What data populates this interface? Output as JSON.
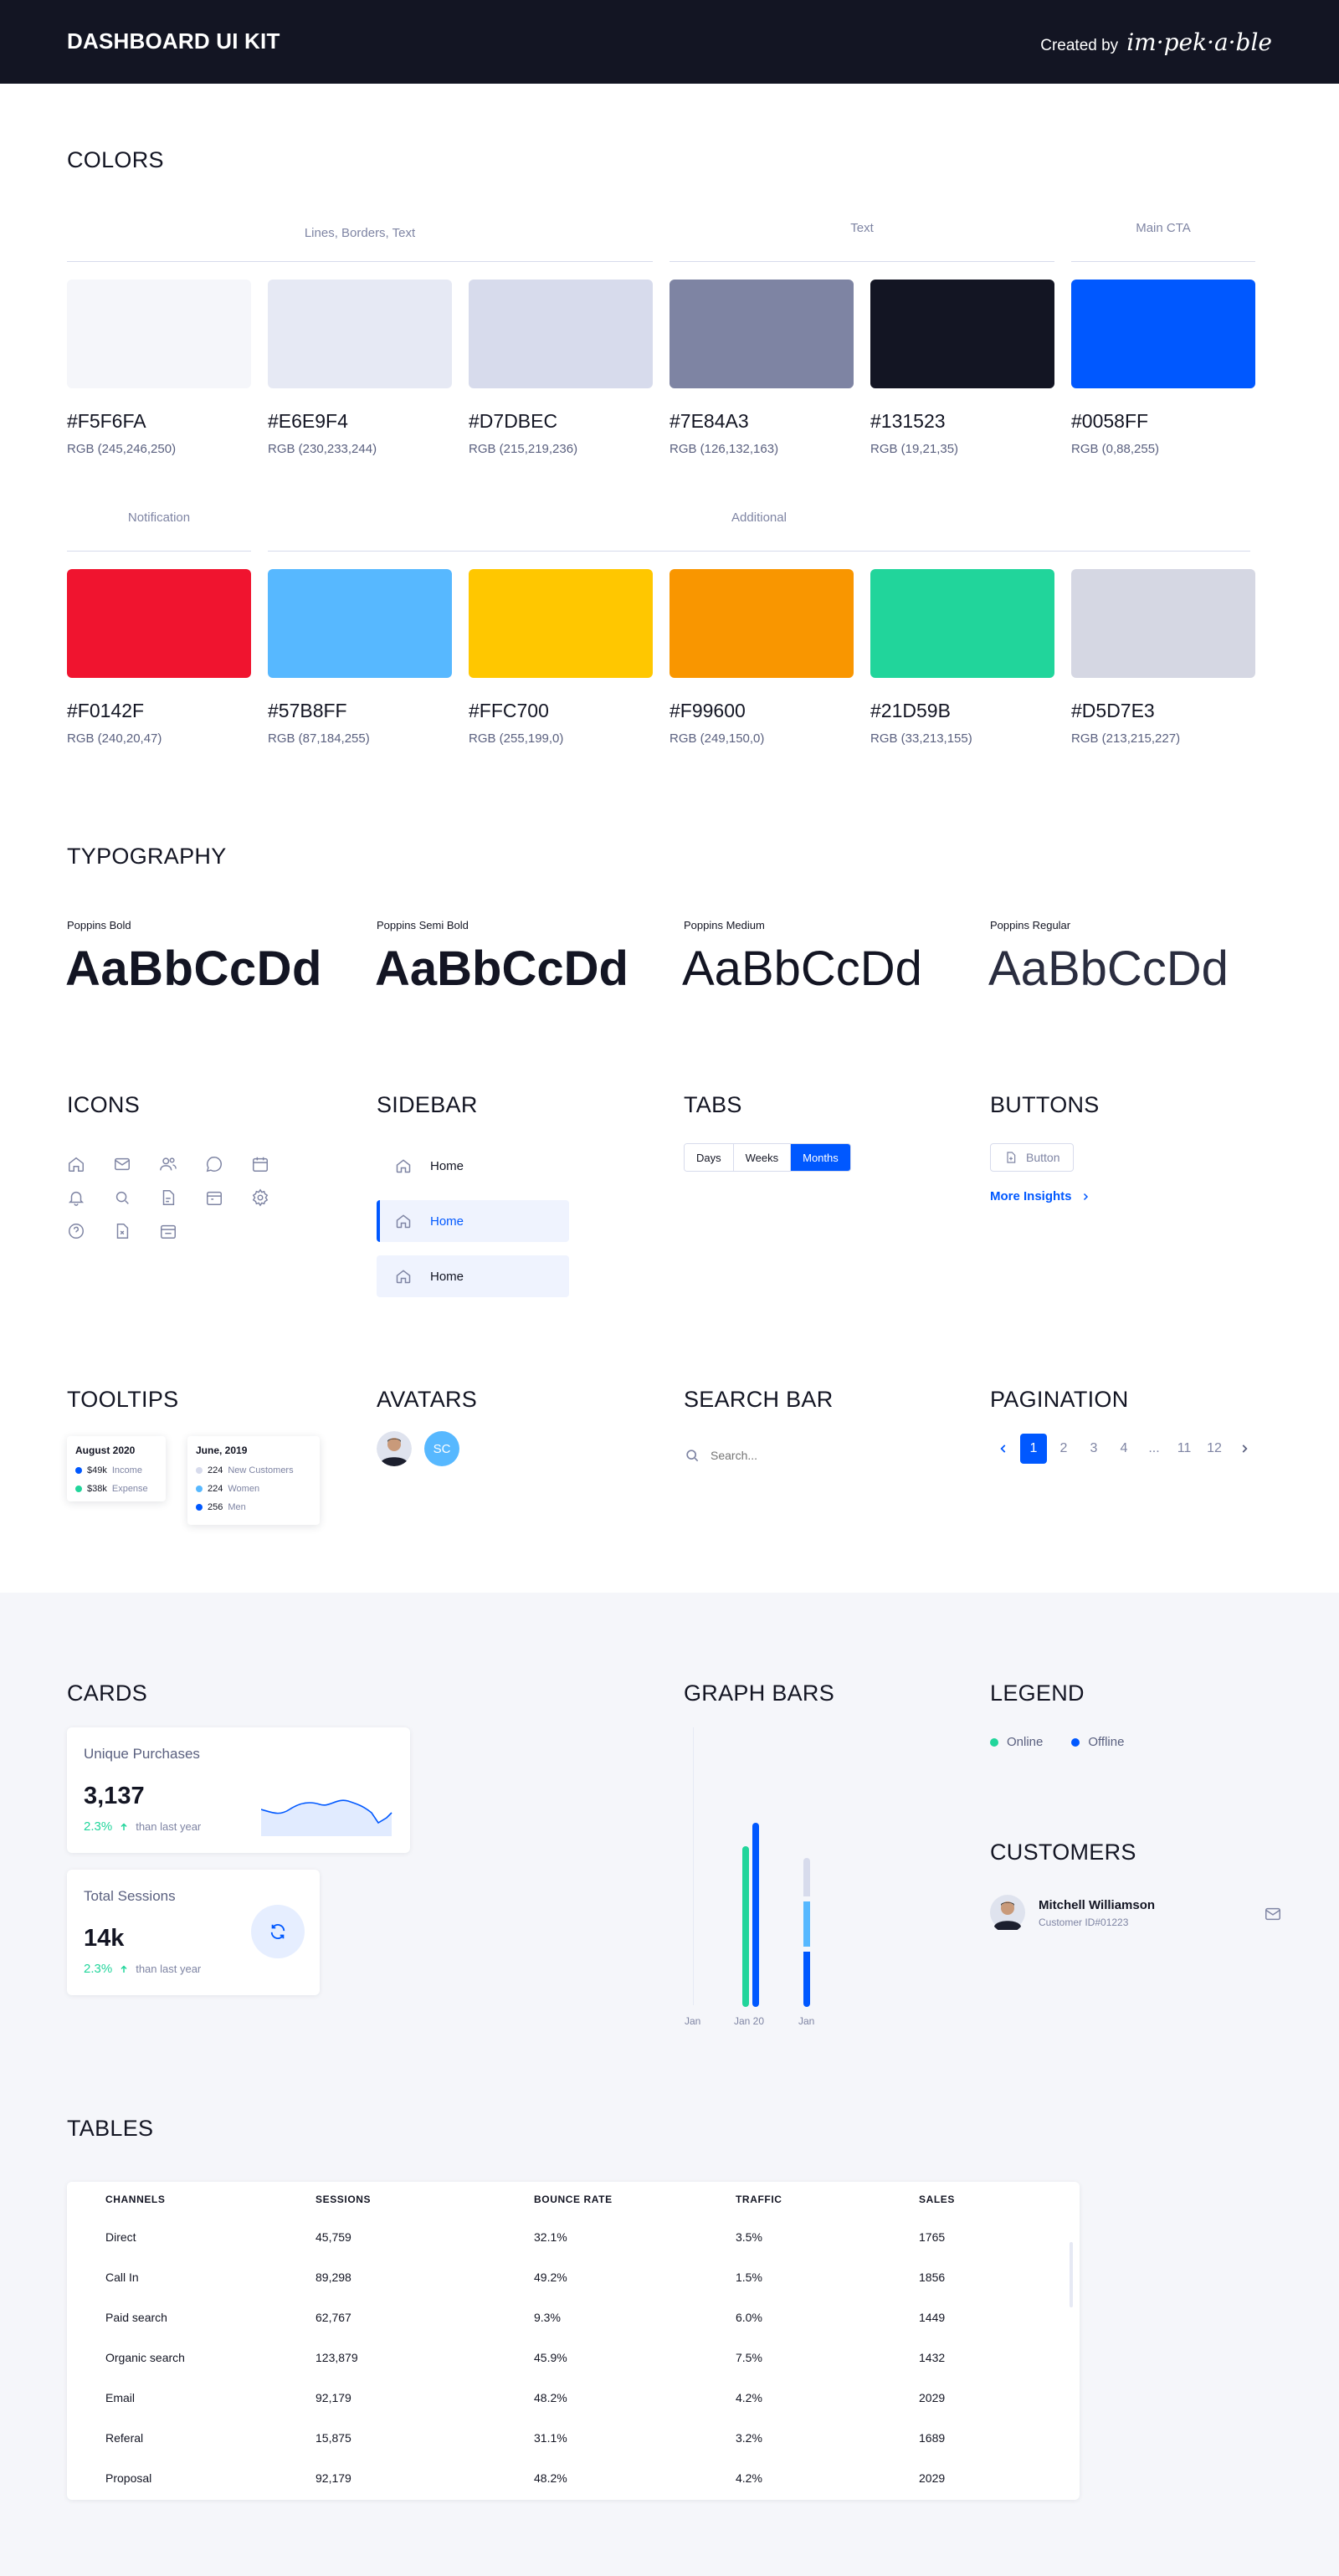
{
  "header": {
    "title": "DASHBOARD UI KIT",
    "created_by": "Created by",
    "brand": "im·pek·a·ble"
  },
  "colors": {
    "title": "COLORS",
    "groups": {
      "lines": "Lines, Borders, Text",
      "text": "Text",
      "cta": "Main CTA",
      "notification": "Notification",
      "additional": "Additional"
    },
    "row1": [
      {
        "hex": "#F5F6FA",
        "rgb": "RGB (245,246,250)"
      },
      {
        "hex": "#E6E9F4",
        "rgb": "RGB (230,233,244)"
      },
      {
        "hex": "#D7DBEC",
        "rgb": "RGB (215,219,236)"
      },
      {
        "hex": "#7E84A3",
        "rgb": "RGB (126,132,163)"
      },
      {
        "hex": "#131523",
        "rgb": "RGB (19,21,35)"
      },
      {
        "hex": "#0058FF",
        "rgb": "RGB (0,88,255)"
      }
    ],
    "row2": [
      {
        "hex": "#F0142F",
        "rgb": "RGB (240,20,47)"
      },
      {
        "hex": "#57B8FF",
        "rgb": "RGB (87,184,255)"
      },
      {
        "hex": "#FFC700",
        "rgb": "RGB (255,199,0)"
      },
      {
        "hex": "#F99600",
        "rgb": "RGB (249,150,0)"
      },
      {
        "hex": "#21D59B",
        "rgb": "RGB (33,213,155)"
      },
      {
        "hex": "#D5D7E3",
        "rgb": "RGB (213,215,227)"
      }
    ]
  },
  "typography": {
    "title": "TYPOGRAPHY",
    "fonts": [
      {
        "label": "Poppins Bold",
        "sample": "AaBbCcDd"
      },
      {
        "label": "Poppins Semi Bold",
        "sample": "AaBbCcDd"
      },
      {
        "label": "Poppins Medium",
        "sample": "AaBbCcDd"
      },
      {
        "label": "Poppins  Regular",
        "sample": "AaBbCcDd"
      }
    ]
  },
  "icons": {
    "title": "ICONS",
    "names": [
      "home-icon",
      "mail-icon",
      "users-icon",
      "chat-icon",
      "calendar-icon",
      "bell-icon",
      "search-icon",
      "file-icon",
      "calendar-alt-icon",
      "gear-icon",
      "help-icon",
      "document-icon",
      "calendar-check-icon"
    ]
  },
  "sidebar": {
    "title": "SIDEBAR",
    "items": [
      {
        "label": "Home"
      },
      {
        "label": "Home"
      },
      {
        "label": "Home"
      }
    ]
  },
  "tabs": {
    "title": "TABS",
    "items": [
      "Days",
      "Weeks",
      "Months"
    ],
    "active": "Months"
  },
  "buttons": {
    "title": "BUTTONS",
    "button_label": "Button",
    "link_label": "More Insights"
  },
  "tooltips": {
    "title": "TOOLTIPS",
    "t1": {
      "title": "August 2020",
      "rows": [
        {
          "value": "$49k",
          "label": "Income",
          "color": "#0058FF"
        },
        {
          "value": "$38k",
          "label": "Expense",
          "color": "#21D59B"
        }
      ]
    },
    "t2": {
      "title": "June, 2019",
      "rows": [
        {
          "value": "224",
          "label": "New Customers",
          "color": "#D7DBEC"
        },
        {
          "value": "224",
          "label": "Women",
          "color": "#57B8FF"
        },
        {
          "value": "256",
          "label": "Men",
          "color": "#0058FF"
        }
      ]
    }
  },
  "avatars": {
    "title": "AVATARS",
    "initials": "SC"
  },
  "search": {
    "title": "SEARCH BAR",
    "placeholder": "Search..."
  },
  "pagination": {
    "title": "PAGINATION",
    "pages": [
      "1",
      "2",
      "3",
      "4",
      "...",
      "11",
      "12"
    ],
    "active": "1"
  },
  "cards": {
    "title": "CARDS",
    "c1": {
      "title": "Unique Purchases",
      "value": "3,137",
      "pct": "2.3%",
      "sub": "than last year"
    },
    "c2": {
      "title": "Total Sessions",
      "value": "14k",
      "pct": "2.3%",
      "sub": "than last year"
    }
  },
  "graph_bars": {
    "title": "GRAPH BARS",
    "labels": [
      "Jan",
      "Jan 20",
      "Jan"
    ]
  },
  "legend": {
    "title": "LEGEND",
    "items": [
      {
        "label": "Online",
        "color": "#21D59B"
      },
      {
        "label": "Offline",
        "color": "#0058FF"
      }
    ]
  },
  "customers": {
    "title": "CUSTOMERS",
    "name": "Mitchell Williamson",
    "id": "Customer ID#01223"
  },
  "tables": {
    "title": "TABLES",
    "headers": [
      "CHANNELS",
      "SESSIONS",
      "BOUNCE RATE",
      "TRAFFIC",
      "SALES"
    ],
    "rows": [
      [
        "Direct",
        "45,759",
        "32.1%",
        "3.5%",
        "1765"
      ],
      [
        "Call In",
        "89,298",
        "49.2%",
        "1.5%",
        "1856"
      ],
      [
        "Paid search",
        "62,767",
        "9.3%",
        "6.0%",
        "1449"
      ],
      [
        "Organic search",
        "123,879",
        "45.9%",
        "7.5%",
        "1432"
      ],
      [
        "Email",
        "92,179",
        "48.2%",
        "4.2%",
        "2029"
      ],
      [
        "Referal",
        "15,875",
        "31.1%",
        "3.2%",
        "1689"
      ],
      [
        "Proposal",
        "92,179",
        "48.2%",
        "4.2%",
        "2029"
      ]
    ]
  }
}
